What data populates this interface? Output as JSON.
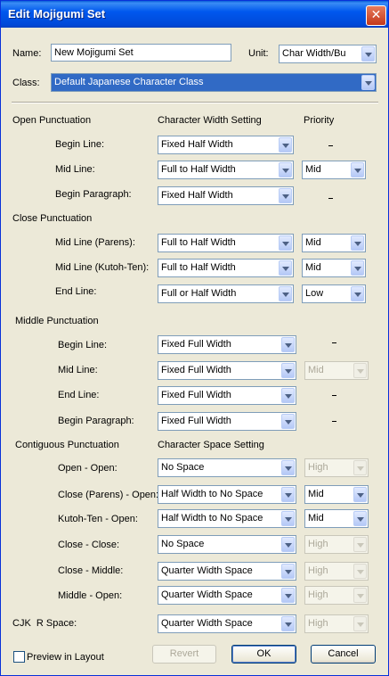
{
  "window": {
    "title": "Edit Mojigumi Set",
    "close_glyph": "✕"
  },
  "name_label": "Name:",
  "name_value": "New Mojigumi Set",
  "unit_label": "Unit:",
  "unit_value": "Char Width/Bu",
  "class_label": "Class:",
  "class_value": "Default Japanese Character Class",
  "headers": {
    "open_punct": "Open Punctuation",
    "char_width_setting": "Character Width Setting",
    "priority": "Priority",
    "close_punct": "Close Punctuation",
    "middle_punct": "Middle Punctuation",
    "contig_punct": "Contiguous Punctuation",
    "char_space_setting": "Character Space Setting"
  },
  "open": [
    {
      "label": "Begin Line:",
      "setting": "Fixed Half Width",
      "priority": "-"
    },
    {
      "label": "Mid Line:",
      "setting": "Full to Half Width",
      "priority": "Mid"
    },
    {
      "label": "Begin Paragraph:",
      "setting": "Fixed Half Width",
      "priority": "-"
    }
  ],
  "close": [
    {
      "label": "Mid Line (Parens):",
      "setting": "Full to Half Width",
      "priority": "Mid"
    },
    {
      "label": "Mid Line (Kutoh-Ten):",
      "setting": "Full to Half Width",
      "priority": "Mid"
    },
    {
      "label": "End Line:",
      "setting": "Full or Half Width",
      "priority": "Low"
    }
  ],
  "middle": [
    {
      "label": "Begin Line:",
      "setting": "Fixed Full Width",
      "priority": "-"
    },
    {
      "label": "Mid Line:",
      "setting": "Fixed Full Width",
      "priority": "Mid"
    },
    {
      "label": "End Line:",
      "setting": "Fixed Full Width",
      "priority": "-"
    },
    {
      "label": "Begin Paragraph:",
      "setting": "Fixed Full Width",
      "priority": "-"
    }
  ],
  "contig": [
    {
      "label": "Open - Open:",
      "setting": "No Space",
      "priority": "High"
    },
    {
      "label": "Close (Parens) - Open:",
      "setting": "Half Width to No Space",
      "priority": "Mid"
    },
    {
      "label": "Kutoh-Ten - Open:",
      "setting": "Half Width to No Space",
      "priority": "Mid"
    },
    {
      "label": "Close - Close:",
      "setting": "No Space",
      "priority": "High"
    },
    {
      "label": "Close - Middle:",
      "setting": "Quarter Width Space",
      "priority": "High"
    },
    {
      "label": "Middle - Open:",
      "setting": "Quarter Width Space",
      "priority": "High"
    }
  ],
  "cjk": {
    "label": "CJK  R Space:",
    "setting": "Quarter Width Space",
    "priority": "High"
  },
  "footer": {
    "preview_label": "Preview in Layout",
    "revert": "Revert",
    "ok": "OK",
    "cancel": "Cancel"
  }
}
